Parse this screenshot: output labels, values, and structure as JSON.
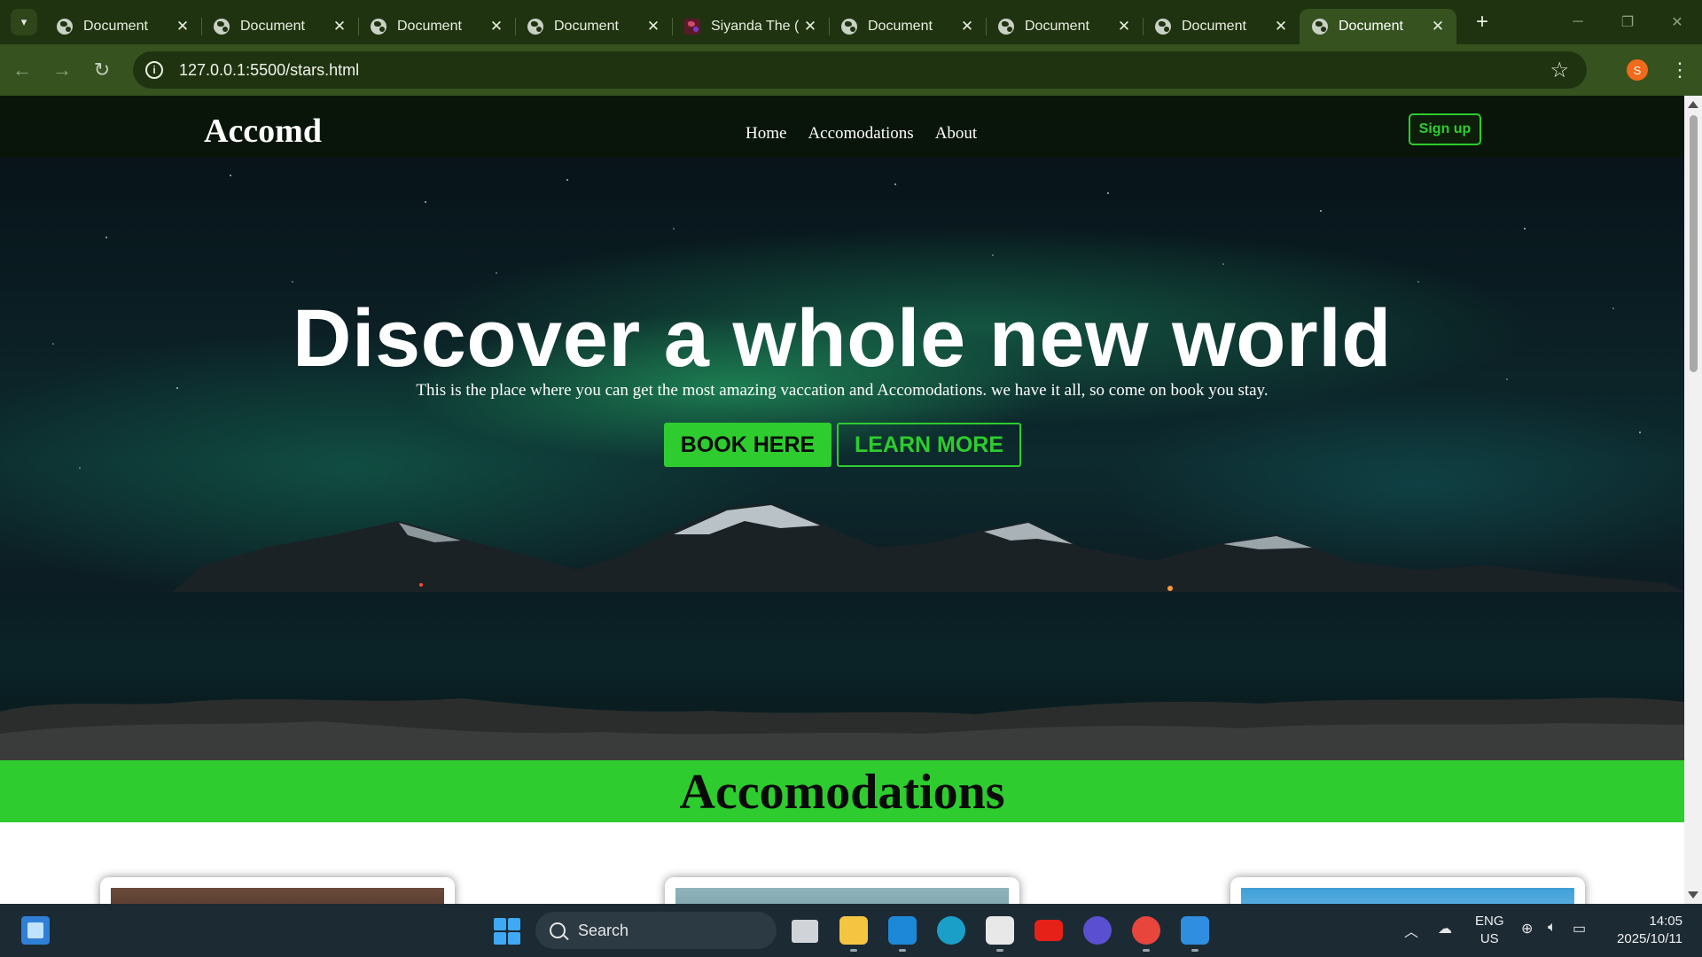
{
  "browser": {
    "tabs": [
      {
        "title": "Document",
        "favicon": "globe-icon"
      },
      {
        "title": "Document",
        "favicon": "globe-icon"
      },
      {
        "title": "Document",
        "favicon": "globe-icon"
      },
      {
        "title": "Document",
        "favicon": "globe-icon"
      },
      {
        "title": "Siyanda The (",
        "favicon": "site-favicon"
      },
      {
        "title": "Document",
        "favicon": "globe-icon"
      },
      {
        "title": "Document",
        "favicon": "globe-icon"
      },
      {
        "title": "Document",
        "favicon": "globe-icon"
      },
      {
        "title": "Document",
        "favicon": "globe-icon",
        "active": true
      }
    ],
    "tab_close": "✕",
    "new_tab": "+",
    "url": "127.0.0.1:5500/stars.html",
    "profile_initial": "S",
    "theme_color": "#1f3310",
    "profile_color": "#f26a1b"
  },
  "site": {
    "logo": "Accomd",
    "nav": [
      "Home",
      "Accomodations",
      "About"
    ],
    "signup": "Sign up",
    "accent": "#2ecc2e",
    "hero": {
      "title": "Discover a whole new world",
      "subtitle": "This is the place where you can get the most amazing vaccation and Accomodations. we have it all, so come on book you stay.",
      "primary_button": "BOOK HERE",
      "secondary_button": "LEARN MORE"
    },
    "section_heading": "Accomodations"
  },
  "taskbar": {
    "search_label": "Search",
    "lang_top": "ENG",
    "lang_bottom": "US",
    "time": "14:05",
    "date": "2025/10/11"
  }
}
